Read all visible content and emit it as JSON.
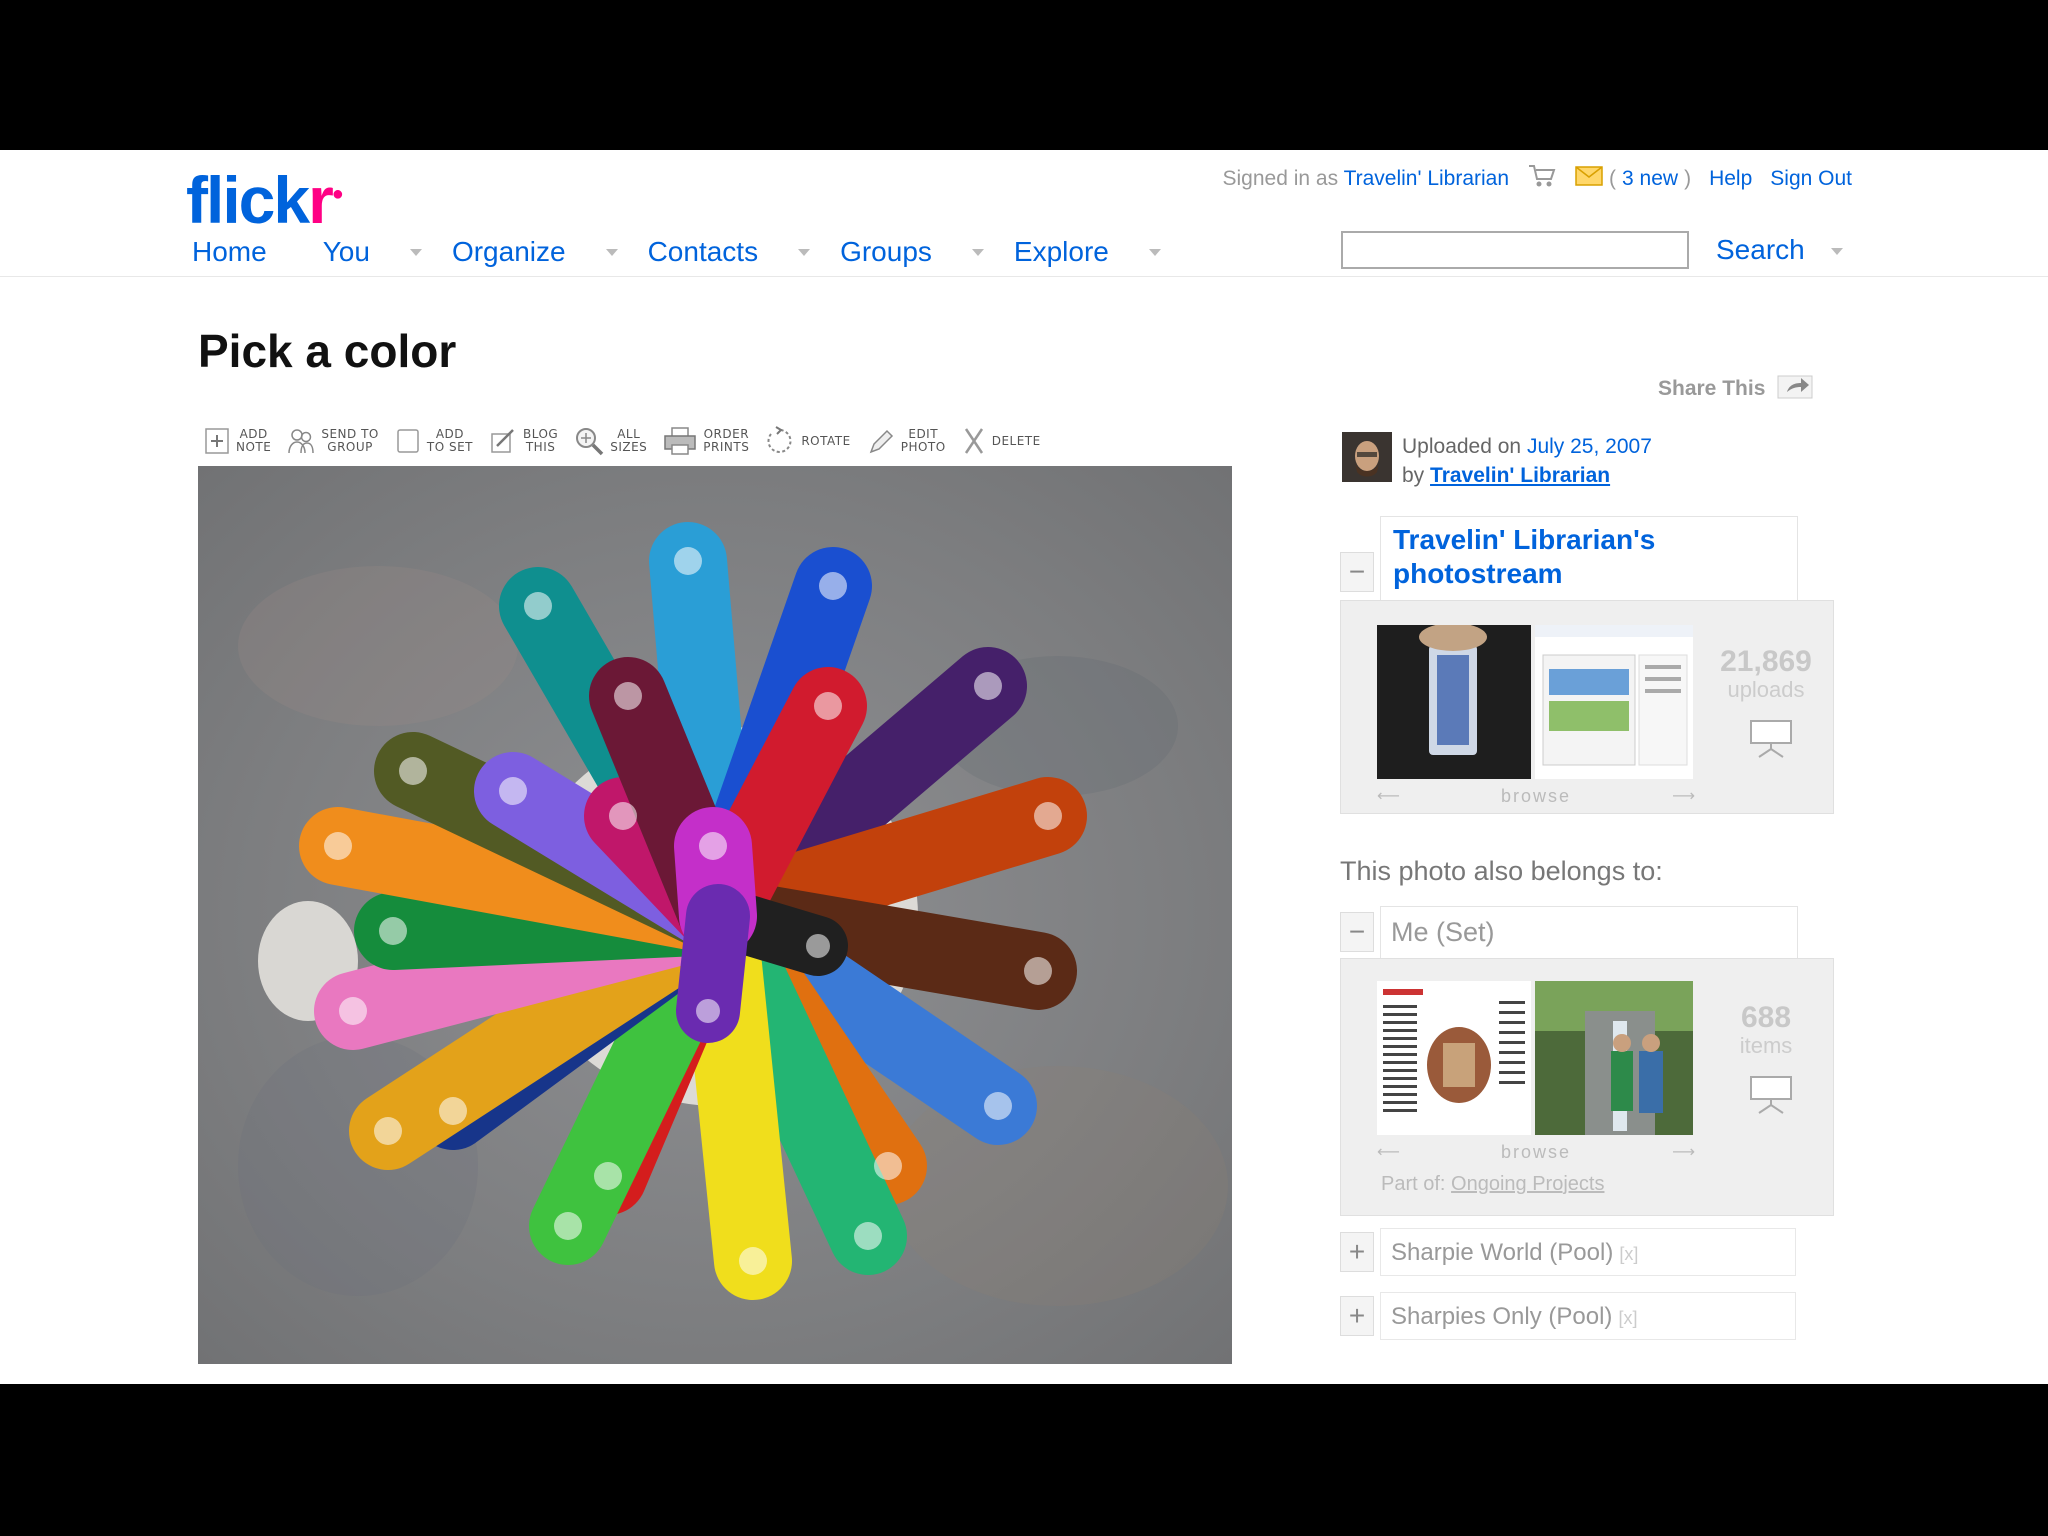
{
  "header": {
    "logo_main": "flick",
    "logo_accent": "r",
    "signed_in_prefix": "Signed in as",
    "user_name": "Travelin' Librarian",
    "mail_count": "3 new",
    "help": "Help",
    "sign_out": "Sign Out",
    "search_button": "Search",
    "search_value": ""
  },
  "nav": {
    "home": "Home",
    "you": "You",
    "organize": "Organize",
    "contacts": "Contacts",
    "groups": "Groups",
    "explore": "Explore"
  },
  "photo": {
    "title": "Pick a color",
    "share_this": "Share This"
  },
  "toolbar": {
    "add_note": [
      "ADD",
      "NOTE"
    ],
    "send_to_group": [
      "SEND TO",
      "GROUP"
    ],
    "add_to_set": [
      "ADD",
      "TO SET"
    ],
    "blog_this": [
      "BLOG",
      "THIS"
    ],
    "all_sizes": [
      "ALL",
      "SIZES"
    ],
    "order_prints": [
      "ORDER",
      "PRINTS"
    ],
    "rotate": "ROTATE",
    "edit_photo": [
      "EDIT",
      "PHOTO"
    ],
    "delete": "DELETE"
  },
  "sidebar": {
    "uploaded_prefix": "Uploaded on",
    "uploaded_date": "July 25, 2007",
    "by_prefix": "by",
    "by_user": "Travelin' Librarian",
    "photostream": {
      "title": "Travelin' Librarian's photostream",
      "count": "21,869",
      "count_label": "uploads",
      "browse": "browse",
      "toggle": "−"
    },
    "also_belongs": "This photo also belongs to:",
    "set": {
      "title": "Me (Set)",
      "count": "688",
      "count_label": "items",
      "browse": "browse",
      "part_of_prefix": "Part of:",
      "part_of": "Ongoing Projects",
      "toggle": "−"
    },
    "pools": [
      {
        "title": "Sharpie World (Pool)",
        "remove": "[x]",
        "toggle": "+"
      },
      {
        "title": "Sharpies Only (Pool)",
        "remove": "[x]",
        "toggle": "+"
      }
    ]
  }
}
